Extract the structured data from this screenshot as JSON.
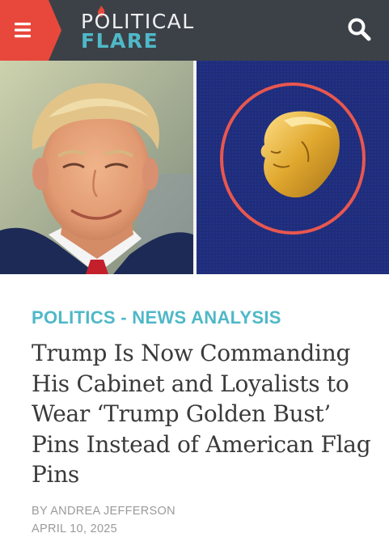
{
  "header": {
    "menu_icon": "hamburger-menu-icon",
    "logo": {
      "line1": "POLITICAL",
      "line2": "FLARE"
    },
    "search_icon": "search-icon",
    "colors": {
      "bar": "#3c4147",
      "menu_accent": "#e8483b",
      "logo_accent": "#4fb8c8"
    }
  },
  "hero": {
    "left_image": "portrait-photo",
    "right_image": "golden-bust-pin-photo"
  },
  "article": {
    "category": "POLITICS - NEWS ANALYSIS",
    "headline": "Trump Is Now Commanding His Cabinet and Loyalists to Wear ‘Trump Golden Bust’ Pins Instead of American Flag Pins",
    "byline": "BY ANDREA JEFFERSON",
    "date": "APRIL 10, 2025"
  }
}
